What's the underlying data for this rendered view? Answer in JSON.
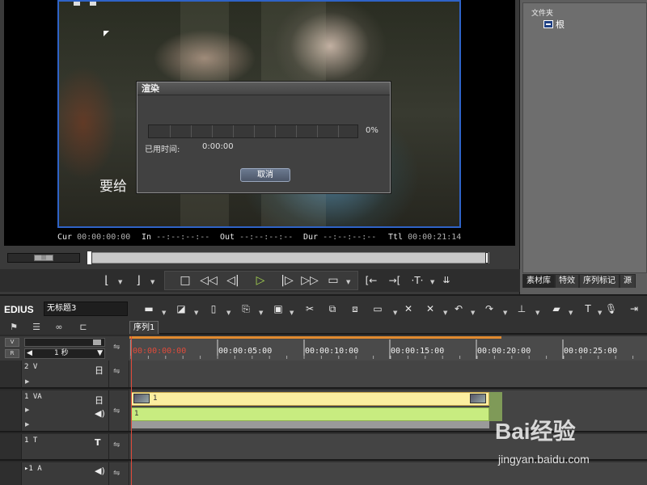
{
  "preview": {
    "subtitle_text": "要给",
    "render_dialog": {
      "title": "渲染",
      "progress_percent": 0,
      "progress_text": "0%",
      "elapsed_label": "已用时间:",
      "elapsed_value": "0:00:00",
      "cancel_label": "取消"
    },
    "timecodes": {
      "cur_label": "Cur",
      "cur_value": "00:00:00:00",
      "in_label": "In",
      "in_value": "--:--:--:--",
      "out_label": "Out",
      "out_value": "--:--:--:--",
      "dur_label": "Dur",
      "dur_value": "--:--:--:--",
      "ttl_label": "Ttl",
      "ttl_value": "00:00:21:14"
    },
    "mini_slider_label": "|||"
  },
  "bin": {
    "folder_title": "文件夹",
    "root_label": "根",
    "tabs": [
      "素材库",
      "特效",
      "序列标记",
      "源"
    ]
  },
  "timeline": {
    "app_name": "EDIUS",
    "project_name": "无标题3",
    "sequence_tab": "序列1",
    "scale_label": "1 秒",
    "ruler": [
      "00:00:00:00",
      "00:00:05:00",
      "00:00:10:00",
      "00:00:15:00",
      "00:00:20:00",
      "00:00:25:00"
    ],
    "tracks": [
      {
        "name": "2 V"
      },
      {
        "name": "1 VA",
        "video_clip_label": "1",
        "audio_clip_label": "1"
      },
      {
        "name": "1 T"
      },
      {
        "name": "1 A"
      }
    ]
  },
  "watermark": {
    "brand": "Bai经验",
    "url": "jingyan.baidu.com"
  },
  "colors": {
    "accent_blue": "#2f63c7",
    "playhead_red": "#e04a3a",
    "video_clip": "#fbeea0",
    "audio_clip": "#c8ec80"
  }
}
